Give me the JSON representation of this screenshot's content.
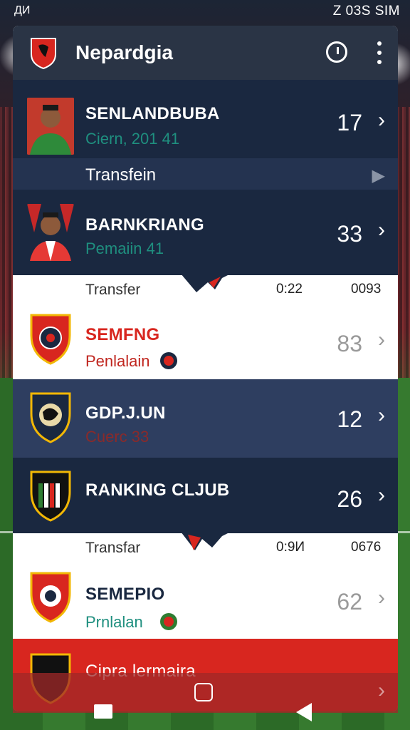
{
  "status_bar": {
    "left": "ДИ",
    "right": "Z 03S SIM"
  },
  "header": {
    "title": "Nepardgia",
    "history_icon": "history-icon",
    "menu_icon": "more-vert-icon"
  },
  "rows": [
    {
      "name": "SENLANDBUBA",
      "meta": "Ciern, 201 41",
      "value": "17"
    },
    {
      "name": "BARNKRIANG",
      "meta": "Pemaiin 41",
      "value": "33"
    },
    {
      "name": "SEMFNG",
      "meta": "Penlalain",
      "value": "83"
    },
    {
      "name": "GDP.J.UN",
      "meta": "Cuerc 33",
      "value": "12"
    },
    {
      "name": "RANKING CLJUB",
      "value": "26"
    },
    {
      "name": "SEMEPIO",
      "meta": "Prnlalan",
      "value": "62"
    },
    {
      "name": "Cipra lermaira"
    }
  ],
  "sub_row": {
    "label": "Transfein"
  },
  "strips": [
    {
      "label": "Transfer",
      "a": "0:22",
      "b": "0093"
    },
    {
      "label": "Transfar",
      "a": "0:9И",
      "b": "0676"
    }
  ],
  "colors": {
    "dark": "#1a2840",
    "accent_red": "#d8261f",
    "teal": "#1f8f7f",
    "green": "#2e7d32"
  }
}
